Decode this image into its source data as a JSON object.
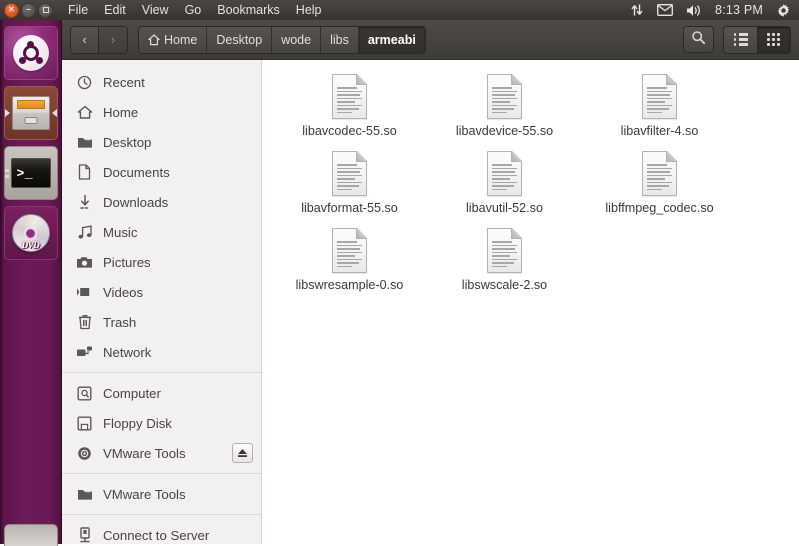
{
  "panel": {
    "window_controls": [
      {
        "name": "close",
        "glyph": "×"
      },
      {
        "name": "minimize",
        "glyph": "−"
      },
      {
        "name": "maximize",
        "glyph": ""
      }
    ],
    "menus": [
      "File",
      "Edit",
      "View",
      "Go",
      "Bookmarks",
      "Help"
    ],
    "tray": {
      "icons": [
        "network-updown-icon",
        "mail-envelope-icon",
        "volume-speaker-icon",
        "gear-icon"
      ],
      "clock": "8:13 PM"
    }
  },
  "launcher": {
    "items": [
      {
        "name": "ubuntu-dash-icon",
        "label": "Ubuntu"
      },
      {
        "name": "files-nautilus-icon",
        "label": "Files"
      },
      {
        "name": "terminal-icon",
        "label": "Terminal",
        "prompt": ">_"
      },
      {
        "name": "dvd-icon",
        "label": "DVD",
        "disc_text": "DVD"
      },
      {
        "name": "partial-icon",
        "label": ""
      }
    ]
  },
  "toolbar": {
    "back_glyph": "‹",
    "forward_glyph": "›",
    "back_label": "Back",
    "forward_label": "Forward",
    "search_label": "Search",
    "list_view_label": "List view",
    "icon_view_label": "Icon view",
    "breadcrumbs": [
      {
        "label": "Home",
        "icon": "home-icon",
        "active": false
      },
      {
        "label": "Desktop",
        "icon": "",
        "active": false
      },
      {
        "label": "wode",
        "icon": "",
        "active": false
      },
      {
        "label": "libs",
        "icon": "",
        "active": false
      },
      {
        "label": "armeabi",
        "icon": "",
        "active": true
      }
    ]
  },
  "sidebar": {
    "groups": [
      {
        "items": [
          {
            "label": "Recent",
            "icon": "clock-icon"
          },
          {
            "label": "Home",
            "icon": "home-icon"
          },
          {
            "label": "Desktop",
            "icon": "folder-icon"
          },
          {
            "label": "Documents",
            "icon": "document-icon"
          },
          {
            "label": "Downloads",
            "icon": "download-arrow-icon"
          },
          {
            "label": "Music",
            "icon": "music-note-icon"
          },
          {
            "label": "Pictures",
            "icon": "camera-icon"
          },
          {
            "label": "Videos",
            "icon": "video-camera-icon"
          },
          {
            "label": "Trash",
            "icon": "trash-icon"
          },
          {
            "label": "Network",
            "icon": "network-icon"
          }
        ]
      },
      {
        "items": [
          {
            "label": "Computer",
            "icon": "computer-icon"
          },
          {
            "label": "Floppy Disk",
            "icon": "floppy-disk-icon"
          },
          {
            "label": "VMware Tools",
            "icon": "optical-disc-icon",
            "eject": true
          }
        ]
      },
      {
        "items": [
          {
            "label": "VMware Tools",
            "icon": "folder-icon"
          }
        ]
      },
      {
        "items": [
          {
            "label": "Connect to Server",
            "icon": "server-icon"
          }
        ]
      }
    ],
    "eject_label": "Eject"
  },
  "content": {
    "files": [
      {
        "name": "libavcodec-55.so",
        "icon": "document-file-icon"
      },
      {
        "name": "libavdevice-55.so",
        "icon": "document-file-icon"
      },
      {
        "name": "libavfilter-4.so",
        "icon": "document-file-icon"
      },
      {
        "name": "libavformat-55.so",
        "icon": "document-file-icon"
      },
      {
        "name": "libavutil-52.so",
        "icon": "document-file-icon"
      },
      {
        "name": "libffmpeg_codec.so",
        "icon": "document-file-icon"
      },
      {
        "name": "libswresample-0.so",
        "icon": "document-file-icon"
      },
      {
        "name": "libswscale-2.so",
        "icon": "document-file-icon"
      }
    ]
  },
  "colors": {
    "panel_bg": "#413d39",
    "toolbar_bg": "#464340",
    "launcher_bg": "#6d1a57",
    "sidebar_bg": "#f2f1f0",
    "content_bg": "#ffffff",
    "accent_orange": "#dd4814",
    "text_light": "#e6e2de",
    "text_dark": "#4a4340"
  }
}
